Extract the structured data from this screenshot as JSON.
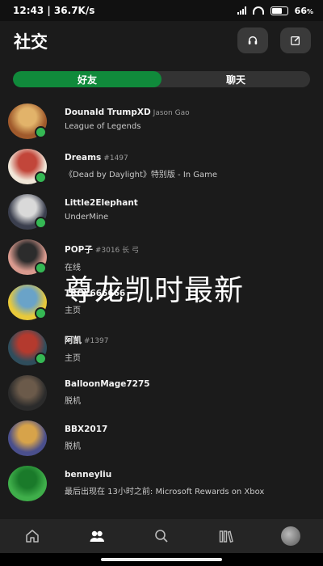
{
  "status_bar": {
    "time_speed": "12:43 | 36.7K/s",
    "battery": "66"
  },
  "header": {
    "title": "社交",
    "headset_icon": "headset-icon",
    "compose_icon": "compose-icon"
  },
  "tabs": [
    {
      "label": "好友",
      "active": true
    },
    {
      "label": "聊天",
      "active": false
    }
  ],
  "friends": [
    {
      "name": "Dounald TrumpXD",
      "sub": "Jason Gao",
      "status": "League of Legends",
      "online": true,
      "colors": [
        "#a05a2c",
        "#e2b36a"
      ]
    },
    {
      "name": "Dreams",
      "sub": "#1497",
      "status": "《Dead by Daylight》特别版 - In Game",
      "online": true,
      "colors": [
        "#f0e6d8",
        "#c2463a"
      ]
    },
    {
      "name": "Little2Elephant",
      "sub": "",
      "status": "UnderMine",
      "online": true,
      "colors": [
        "#3b3f4e",
        "#d9d9d9"
      ]
    },
    {
      "name": "POP子",
      "sub": "#3016 长 弓",
      "status": "在线",
      "online": true,
      "colors": [
        "#d99a8e",
        "#2c2c2c"
      ]
    },
    {
      "name": "TROY666666",
      "sub": "",
      "status": "主页",
      "online": true,
      "colors": [
        "#e8c93a",
        "#6aa3c8"
      ]
    },
    {
      "name": "阿凯",
      "sub": "#1397",
      "status": "主页",
      "online": true,
      "colors": [
        "#2f4d5c",
        "#b43a2e"
      ]
    },
    {
      "name": "BalloonMage7275",
      "sub": "",
      "status": "脱机",
      "online": false,
      "colors": [
        "#2b2b2b",
        "#6b5a4a"
      ]
    },
    {
      "name": "BBX2017",
      "sub": "",
      "status": "脱机",
      "online": false,
      "colors": [
        "#4a4f8c",
        "#d7a34a"
      ]
    },
    {
      "name": "benneyliu",
      "sub": "",
      "status": "最后出现在 13小时之前: Microsoft Rewards on Xbox",
      "online": false,
      "colors": [
        "#3fae4a",
        "#1a7a2a"
      ]
    }
  ],
  "overlay_text": "尊龙凯时最新",
  "bottom_nav": [
    {
      "name": "home-icon"
    },
    {
      "name": "friends-icon",
      "active": true
    },
    {
      "name": "search-icon"
    },
    {
      "name": "library-icon"
    },
    {
      "name": "profile-avatar"
    }
  ]
}
